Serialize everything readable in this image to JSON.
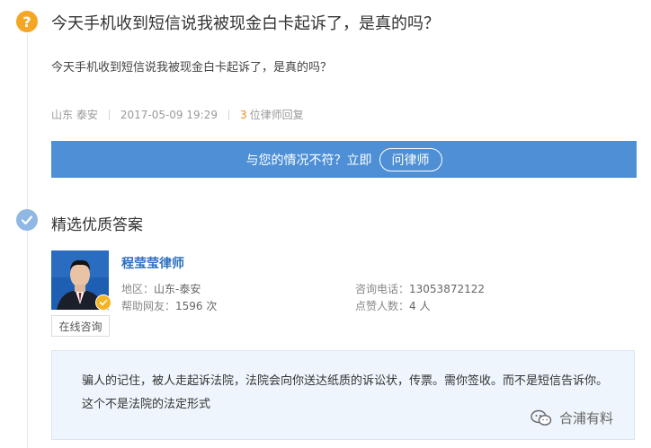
{
  "question": {
    "title": "今天手机收到短信说我被现金白卡起诉了，是真的吗？",
    "body": "今天手机收到短信说我被现金白卡起诉了，是真的吗？",
    "location": "山东 泰安",
    "datetime": "2017-05-09 19:29",
    "reply_count": "3",
    "reply_suffix": "位律师回复"
  },
  "banner": {
    "text": "与您的情况不符？立即",
    "button_label": "问律师"
  },
  "section": {
    "title": "精选优质答案"
  },
  "lawyer": {
    "name": "程莹莹律师",
    "region_label": "地区：",
    "region": "山东-泰安",
    "helped_label": "帮助网友：",
    "helped": "1596 次",
    "phone_label": "咨询电话：",
    "phone": "13053872122",
    "likes_label": "点赞人数：",
    "likes": "4 人",
    "consult_label": "在线咨询"
  },
  "answer": {
    "text": "骗人的记住，被人走起诉法院，法院会向你送达纸质的诉讼状，传票。需你签收。而不是短信告诉你。这个不是法院的法定形式"
  },
  "watermark": {
    "text": "合浦有料"
  },
  "colors": {
    "accent_blue": "#4e8fd6",
    "question_icon": "#f5a623",
    "reply_count": "#f08a1c",
    "lawyer_name": "#2d6fbf",
    "answer_bg": "#eef5fc"
  },
  "icons": {
    "question": "question-mark-icon",
    "section": "check-circle-icon",
    "verified": "verified-badge-icon",
    "watermark": "wechat-icon"
  }
}
